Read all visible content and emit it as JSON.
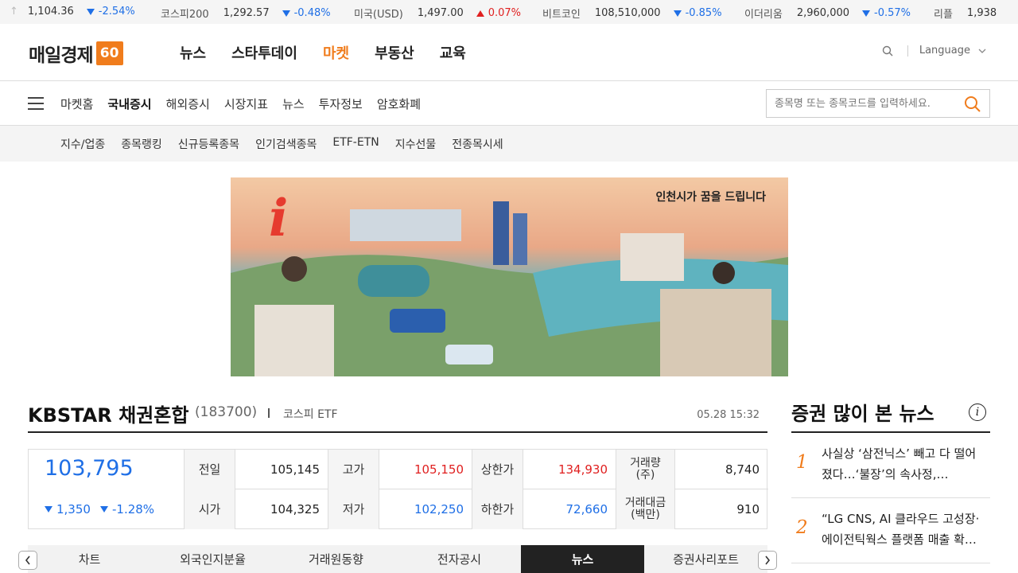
{
  "ticker": {
    "lead_value": "1,104.36",
    "lead_change": "-2.54%",
    "items": [
      {
        "name": "코스피200",
        "value": "1,292.57",
        "change": "-0.48%",
        "dir": "down"
      },
      {
        "name": "미국(USD)",
        "value": "1,497.00",
        "change": "0.07%",
        "dir": "up"
      },
      {
        "name": "비트코인",
        "value": "108,510,000",
        "change": "-0.85%",
        "dir": "down"
      },
      {
        "name": "이더리움",
        "value": "2,960,000",
        "change": "-0.57%",
        "dir": "down"
      },
      {
        "name": "리플",
        "value": "1,938",
        "change": "",
        "dir": ""
      }
    ]
  },
  "header": {
    "logo_text": "매일경제",
    "logo_badge": "60",
    "gnb": [
      "뉴스",
      "스타투데이",
      "마켓",
      "부동산",
      "교육"
    ],
    "language": "Language"
  },
  "subnav": {
    "items": [
      "마켓홈",
      "국내증시",
      "해외증시",
      "시장지표",
      "뉴스",
      "투자정보",
      "암호화폐"
    ],
    "search_placeholder": "종목명 또는 종목코드를 입력하세요."
  },
  "thirdnav": {
    "items": [
      "지수/업종",
      "종목랭킹",
      "신규등록종목",
      "인기검색종목",
      "ETF-ETN",
      "지수선물",
      "전종목시세"
    ]
  },
  "banner": {
    "slogan": "인천시가 꿈을 드립니다",
    "logo_letter": "i"
  },
  "stock": {
    "name": "KBSTAR 채권혼합",
    "code": "(183700)",
    "market": "코스피 ETF",
    "time": "05.28 15:32",
    "price": "103,795",
    "change_abs": "1,350",
    "change_pct": "-1.28%",
    "labels": {
      "prev": "전일",
      "high": "고가",
      "upper": "상한가",
      "volume": "거래량\n(주)",
      "open": "시가",
      "low": "저가",
      "lower": "하한가",
      "amount": "거래대금\n(백만)"
    },
    "values": {
      "prev": "105,145",
      "high": "105,150",
      "upper": "134,930",
      "volume": "8,740",
      "open": "104,325",
      "low": "102,250",
      "lower": "72,660",
      "amount": "910"
    }
  },
  "tabs": [
    "차트",
    "외국인지분율",
    "거래원동향",
    "전자공시",
    "뉴스",
    "증권사리포트"
  ],
  "side": {
    "title": "증권 많이 본 뉴스",
    "news": [
      {
        "rank": "1",
        "title": "사실상 ‘삼전닉스’ 빼고 다 떨어졌다…‘불장’의 속사정,…"
      },
      {
        "rank": "2",
        "title": "“LG CNS, AI 클라우드 고성장·에이전틱웍스 플랫폼 매출 확…"
      }
    ]
  },
  "colors": {
    "accent": "#f07c1c",
    "down": "#1f6fe6",
    "up": "#e02020"
  }
}
